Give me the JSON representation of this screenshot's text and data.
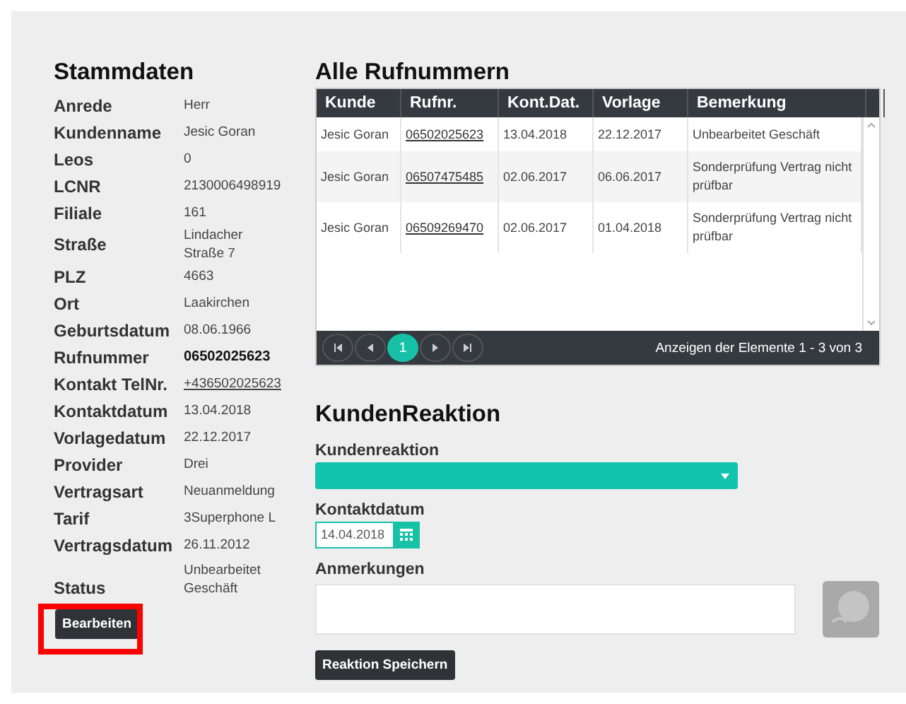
{
  "stammdaten": {
    "title": "Stammdaten",
    "fields": [
      {
        "label": "Anrede",
        "value": "Herr",
        "kind": "text"
      },
      {
        "label": "Kundenname",
        "value": "Jesic Goran",
        "kind": "text"
      },
      {
        "label": "Leos",
        "value": "0",
        "kind": "text"
      },
      {
        "label": "LCNR",
        "value": "2130006498919",
        "kind": "text"
      },
      {
        "label": "Filiale",
        "value": "161",
        "kind": "text"
      },
      {
        "label": "Straße",
        "value": "Lindacher Straße 7",
        "kind": "text"
      },
      {
        "label": "PLZ",
        "value": "4663",
        "kind": "text"
      },
      {
        "label": "Ort",
        "value": "Laakirchen",
        "kind": "text"
      },
      {
        "label": "Geburtsdatum",
        "value": "08.06.1966",
        "kind": "text"
      },
      {
        "label": "Rufnummer",
        "value": "06502025623",
        "kind": "bold"
      },
      {
        "label": "Kontakt TelNr.",
        "value": "+436502025623",
        "kind": "link"
      },
      {
        "label": "Kontaktdatum",
        "value": "13.04.2018",
        "kind": "text"
      },
      {
        "label": "Vorlagedatum",
        "value": "22.12.2017",
        "kind": "text"
      },
      {
        "label": "Provider",
        "value": "Drei",
        "kind": "text"
      },
      {
        "label": "Vertragsart",
        "value": "Neuanmeldung",
        "kind": "text"
      },
      {
        "label": "Tarif",
        "value": "3Superphone L",
        "kind": "text"
      },
      {
        "label": "Vertragsdatum",
        "value": "26.11.2012",
        "kind": "text"
      },
      {
        "label": "Status",
        "value": "Unbearbeitet Geschäft",
        "kind": "text"
      }
    ],
    "edit_button": {
      "label": "Bearbeiten",
      "highlighted": true
    }
  },
  "rufnummern": {
    "title": "Alle Rufnummern",
    "columns": [
      {
        "label": "Kunde",
        "kind": "text"
      },
      {
        "label": "Rufnr.",
        "kind": "link"
      },
      {
        "label": "Kont.Dat.",
        "kind": "text"
      },
      {
        "label": "Vorlage",
        "kind": "text"
      },
      {
        "label": "Bemerkung",
        "kind": "text"
      }
    ],
    "rows": [
      [
        "Jesic Goran",
        "06502025623",
        "13.04.2018",
        "22.12.2017",
        "Unbearbeitet Geschäft"
      ],
      [
        "Jesic Goran",
        "06507475485",
        "02.06.2017",
        "06.06.2017",
        "Sonderprüfung Vertrag nicht prüfbar"
      ],
      [
        "Jesic Goran",
        "06509269470",
        "02.06.2017",
        "01.04.2018",
        "Sonderprüfung Vertrag nicht prüfbar"
      ]
    ],
    "pager": {
      "buttons": [
        {
          "kind": "first",
          "selected": false
        },
        {
          "kind": "prev",
          "selected": false
        },
        {
          "kind": "page",
          "label": "1",
          "selected": true
        },
        {
          "kind": "next",
          "selected": false
        },
        {
          "kind": "last",
          "selected": false
        }
      ],
      "info": "Anzeigen der Elemente 1 - 3 von 3"
    }
  },
  "reaktion": {
    "title": "KundenReaktion",
    "fields": [
      {
        "kind": "select",
        "label": "Kundenreaktion"
      },
      {
        "kind": "date",
        "label": "Kontaktdatum",
        "value": "14.04.2018"
      },
      {
        "kind": "textarea",
        "label": "Anmerkungen"
      }
    ],
    "save_button": "Reaktion Speichern"
  }
}
